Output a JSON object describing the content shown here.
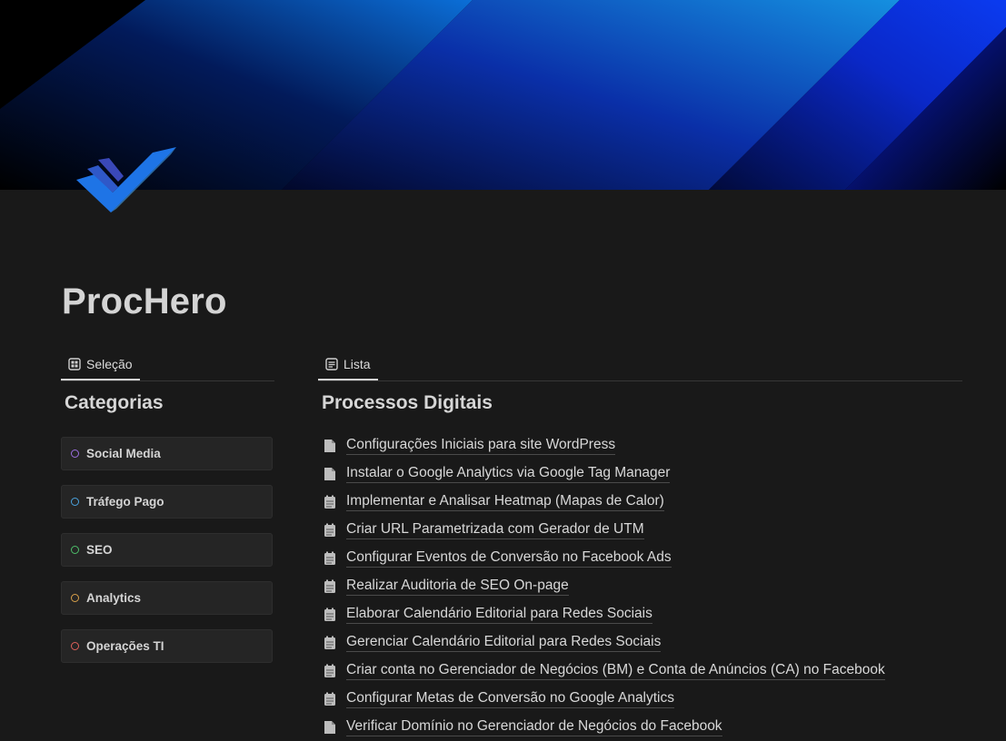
{
  "page": {
    "title": "ProcHero"
  },
  "left": {
    "tab_label": "Seleção",
    "tab_icon": "gallery-view-icon",
    "section_title": "Categorias",
    "categories": [
      {
        "label": "Social Media",
        "color": "#9b6ee0"
      },
      {
        "label": "Tráfego Pago",
        "color": "#4aa3df"
      },
      {
        "label": "SEO",
        "color": "#4dbf6a"
      },
      {
        "label": "Analytics",
        "color": "#d9a04a"
      },
      {
        "label": "Operações TI",
        "color": "#e0605a"
      }
    ]
  },
  "right": {
    "tab_label": "Lista",
    "tab_icon": "list-view-icon",
    "section_title": "Processos Digitais",
    "items": [
      {
        "label": "Configurações Iniciais para site WordPress",
        "icon": "page-icon"
      },
      {
        "label": "Instalar o Google Analytics via Google Tag Manager",
        "icon": "page-icon"
      },
      {
        "label": "Implementar e Analisar Heatmap (Mapas de Calor)",
        "icon": "checklist-icon"
      },
      {
        "label": "Criar URL Parametrizada com Gerador de UTM",
        "icon": "checklist-icon"
      },
      {
        "label": "Configurar Eventos de Conversão no Facebook Ads",
        "icon": "checklist-icon"
      },
      {
        "label": "Realizar Auditoria de SEO On-page",
        "icon": "checklist-icon"
      },
      {
        "label": "Elaborar Calendário Editorial para Redes Sociais",
        "icon": "checklist-icon"
      },
      {
        "label": "Gerenciar Calendário Editorial para Redes Sociais",
        "icon": "checklist-icon"
      },
      {
        "label": "Criar conta no Gerenciador de Negócios (BM) e Conta de Anúncios (CA) no Facebook",
        "icon": "checklist-icon"
      },
      {
        "label": "Configurar Metas de Conversão no Google Analytics",
        "icon": "checklist-icon"
      },
      {
        "label": "Verificar Domínio no Gerenciador de Negócios do Facebook",
        "icon": "page-icon"
      }
    ]
  },
  "colors": {
    "background": "#191919",
    "cover_blue": "#0a2fd6",
    "cover_cyan": "#1aa3e8",
    "logo_blue": "#1e74e6"
  }
}
